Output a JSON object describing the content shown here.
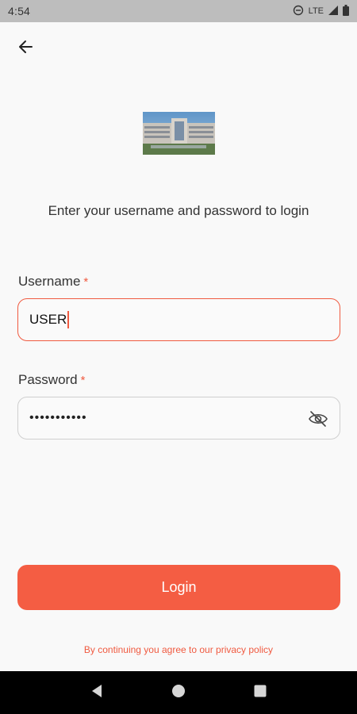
{
  "status_bar": {
    "time": "4:54",
    "network": "LTE"
  },
  "icons": {
    "back": "arrow-left-icon",
    "eye": "eye-off-icon",
    "dnd": "do-not-disturb-icon",
    "signal": "signal-icon",
    "battery": "battery-icon"
  },
  "login": {
    "subtitle": "Enter your username and password to login",
    "username_label": "Username",
    "username_required": "*",
    "username_value": "USER",
    "password_label": "Password",
    "password_required": "*",
    "password_masked": "•••••••••••",
    "button_label": "Login",
    "privacy_text": "By continuing you agree to our privacy policy"
  },
  "colors": {
    "accent": "#f45d43",
    "background": "#f9f9f9"
  }
}
